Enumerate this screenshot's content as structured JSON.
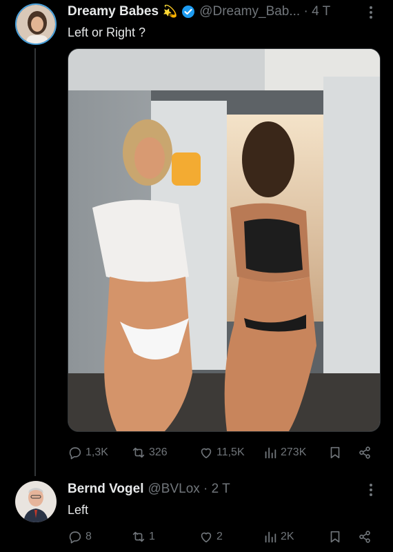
{
  "tweet": {
    "author_name": "Dreamy Babes",
    "author_emoji": "💫",
    "handle_time": "@Dreamy_Bab... · 4 T",
    "text": "Left or Right ?",
    "stats": {
      "replies": "1,3K",
      "reposts": "326",
      "likes": "11,5K",
      "views": "273K"
    }
  },
  "reply": {
    "author_name": "Bernd Vogel",
    "handle_time": "@BVLox · 2 T",
    "text": "Left",
    "stats": {
      "replies": "8",
      "reposts": "1",
      "likes": "2",
      "views": "2K"
    }
  },
  "colors": {
    "background": "#000000",
    "text": "#e7e9ea",
    "muted": "#71767b",
    "verified": "#1d9bf0"
  },
  "icons": [
    "reply-icon",
    "repost-icon",
    "like-icon",
    "views-icon",
    "bookmark-icon",
    "share-icon",
    "verified-badge-icon",
    "more-icon"
  ]
}
